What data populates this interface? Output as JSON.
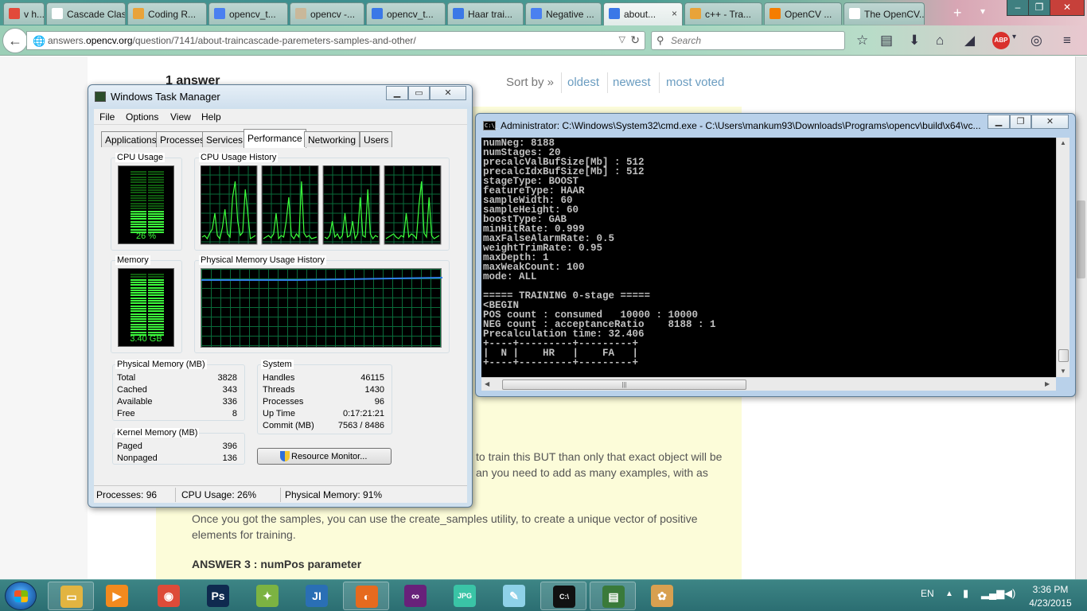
{
  "browser": {
    "tabs": [
      {
        "label": "v h...",
        "favicon": "#e24a3b"
      },
      {
        "label": "Cascade Clas...",
        "favicon": "#ffffff"
      },
      {
        "label": "Coding R...",
        "favicon": "#e9a33a"
      },
      {
        "label": "opencv_t...",
        "favicon": "#4a80f0"
      },
      {
        "label": "opencv -...",
        "favicon": "#c9b89a"
      },
      {
        "label": "opencv_t...",
        "favicon": "#3b78e7"
      },
      {
        "label": "Haar trai...",
        "favicon": "#3b78e7"
      },
      {
        "label": "Negative ...",
        "favicon": "#4a80f0"
      },
      {
        "label": "about...",
        "favicon": "#3b78e7"
      },
      {
        "label": "c++ - Tra...",
        "favicon": "#e8a33a"
      },
      {
        "label": "OpenCV ...",
        "favicon": "#f57d00"
      },
      {
        "label": "The OpenCV...",
        "favicon": "#ffffff"
      }
    ],
    "active_tab_close": "×",
    "new_tab": "+",
    "tab_menu": "▾",
    "url_prefix": "answers.",
    "url_domain": "opencv.org",
    "url_path": "/question/7141/about-traincascade-paremeters-samples-and-other/",
    "url_dropdown": "▽",
    "url_reload": "↻",
    "search_placeholder": "Search",
    "window_min": "–",
    "window_max": "❐",
    "window_close": "✕"
  },
  "page": {
    "answers_count": "1 answer",
    "sort_label": "Sort by »",
    "sort_options": [
      "oldest",
      "newest",
      "most voted"
    ],
    "para1_line1": "to train this BUT than only that exact object will be",
    "para1_line2": "an you need to add as many examples, with as",
    "para2_line1": "Once you got the samples, you can use the create_samples utility, to create a unique vector of positive",
    "para2_line2": "elements for training.",
    "answer3_heading": "ANSWER 3 : numPos parameter"
  },
  "taskmgr": {
    "title": "Windows Task Manager",
    "menu": [
      "File",
      "Options",
      "View",
      "Help"
    ],
    "tabs": [
      "Applications",
      "Processes",
      "Services",
      "Performance",
      "Networking",
      "Users"
    ],
    "active_tab": "Performance",
    "cpu_usage_label": "CPU Usage",
    "cpu_usage_value": "26 %",
    "cpu_usage_fraction": 0.26,
    "cpu_history_label": "CPU Usage History",
    "memory_label": "Memory",
    "memory_value": "3.40 GB",
    "memory_fraction": 0.91,
    "mem_history_label": "Physical Memory Usage History",
    "physical_memory": {
      "label": "Physical Memory (MB)",
      "rows": [
        {
          "k": "Total",
          "v": "3828"
        },
        {
          "k": "Cached",
          "v": "343"
        },
        {
          "k": "Available",
          "v": "336"
        },
        {
          "k": "Free",
          "v": "8"
        }
      ]
    },
    "kernel_memory": {
      "label": "Kernel Memory (MB)",
      "rows": [
        {
          "k": "Paged",
          "v": "396"
        },
        {
          "k": "Nonpaged",
          "v": "136"
        }
      ]
    },
    "system": {
      "label": "System",
      "rows": [
        {
          "k": "Handles",
          "v": "46115"
        },
        {
          "k": "Threads",
          "v": "1430"
        },
        {
          "k": "Processes",
          "v": "96"
        },
        {
          "k": "Up Time",
          "v": "0:17:21:21"
        },
        {
          "k": "Commit (MB)",
          "v": "7563 / 8486"
        }
      ]
    },
    "resource_monitor_button": "Resource Monitor...",
    "status": {
      "processes": "Processes: 96",
      "cpu": "CPU Usage: 26%",
      "memory": "Physical Memory: 91%"
    }
  },
  "cmd": {
    "title": "Administrator: C:\\Windows\\System32\\cmd.exe - C:\\Users\\mankum93\\Downloads\\Programs\\opencv\\build\\x64\\vc...",
    "icon_text": "C:\\_",
    "lines": [
      "numNeg: 8188",
      "numStages: 20",
      "precalcValBufSize[Mb] : 512",
      "precalcIdxBufSize[Mb] : 512",
      "stageType: BOOST",
      "featureType: HAAR",
      "sampleWidth: 60",
      "sampleHeight: 60",
      "boostType: GAB",
      "minHitRate: 0.999",
      "maxFalseAlarmRate: 0.5",
      "weightTrimRate: 0.95",
      "maxDepth: 1",
      "maxWeakCount: 100",
      "mode: ALL",
      "",
      "===== TRAINING 0-stage =====",
      "<BEGIN",
      "POS count : consumed   10000 : 10000",
      "NEG count : acceptanceRatio    8188 : 1",
      "Precalculation time: 32.406",
      "+----+---------+---------+",
      "|  N |    HR   |    FA   |",
      "+----+---------+---------+",
      "",
      "_"
    ]
  },
  "taskbar": {
    "apps": [
      {
        "name": "file-explorer",
        "glyph": "▭",
        "color": "#e2b441"
      },
      {
        "name": "media-player",
        "glyph": "▶",
        "color": "#f28a1e"
      },
      {
        "name": "chrome",
        "glyph": "◉",
        "color": "#dd4b39"
      },
      {
        "name": "photoshop",
        "glyph": "Ps",
        "color": "#0f2a4f"
      },
      {
        "name": "android-studio",
        "glyph": "✦",
        "color": "#7cb342"
      },
      {
        "name": "jetbrains-ide",
        "glyph": "JI",
        "color": "#2a6fb5"
      },
      {
        "name": "firefox",
        "glyph": "◐",
        "color": "#e66a1e"
      },
      {
        "name": "visual-studio",
        "glyph": "∞",
        "color": "#68217a"
      },
      {
        "name": "image-viewer",
        "glyph": "JPG",
        "color": "#3ac4a6"
      },
      {
        "name": "notepad",
        "glyph": "✎",
        "color": "#8ed1e8"
      },
      {
        "name": "cmd",
        "glyph": "C:\\",
        "color": "#111111"
      },
      {
        "name": "task-manager",
        "glyph": "▤",
        "color": "#3a7a3a"
      },
      {
        "name": "paint",
        "glyph": "✿",
        "color": "#d8a050"
      }
    ],
    "lang": "EN",
    "time": "3:36 PM",
    "date": "4/23/2015"
  }
}
